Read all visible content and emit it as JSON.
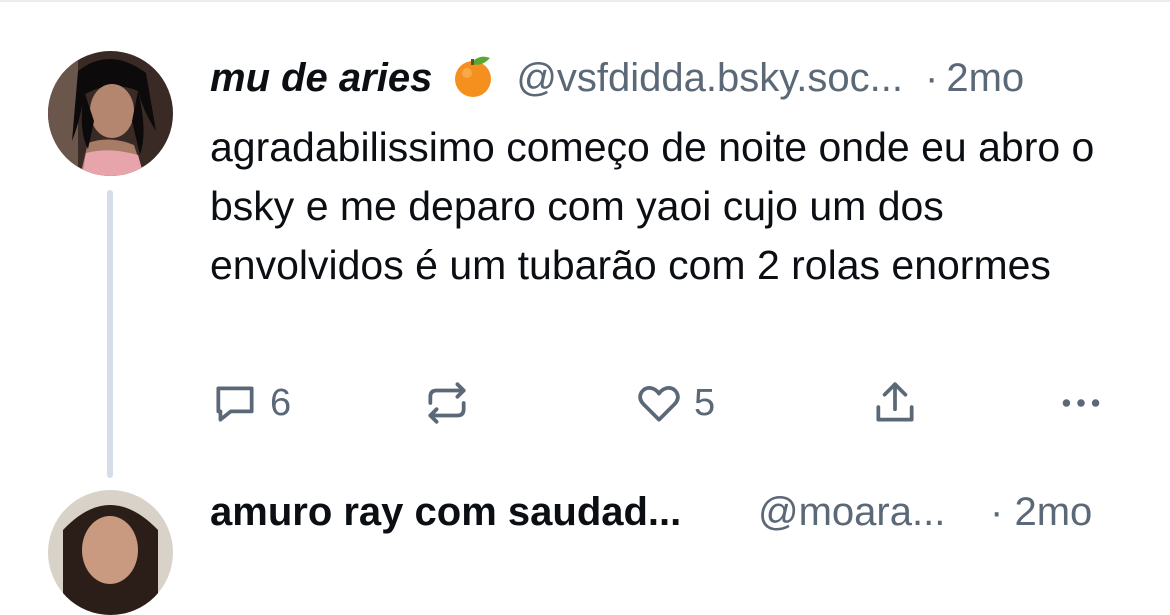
{
  "post": {
    "author": {
      "display_name": "mu de aries",
      "emoji": "🍊",
      "handle": "@vsfdidda.bsky.soc...",
      "avatar_icon": "avatar"
    },
    "separator": "·",
    "time": "2mo",
    "text": "agradabilissimo começo de noite onde eu abro o bsky e me deparo com yaoi cujo um dos envolvidos é um tubarão com 2 rolas enormes",
    "actions": {
      "reply_count": "6",
      "repost_count": "",
      "like_count": "5"
    }
  },
  "next_post": {
    "display_name": "amuro ray com saudad...",
    "handle": "@moara...",
    "separator": "·",
    "time": "2mo"
  },
  "colors": {
    "text": "#0b0f14",
    "secondary": "#5b6877",
    "thread_line": "#d5dde6"
  },
  "icons": [
    "reply-icon",
    "repost-icon",
    "like-icon",
    "share-icon",
    "more-icon",
    "orange-emoji-icon"
  ]
}
